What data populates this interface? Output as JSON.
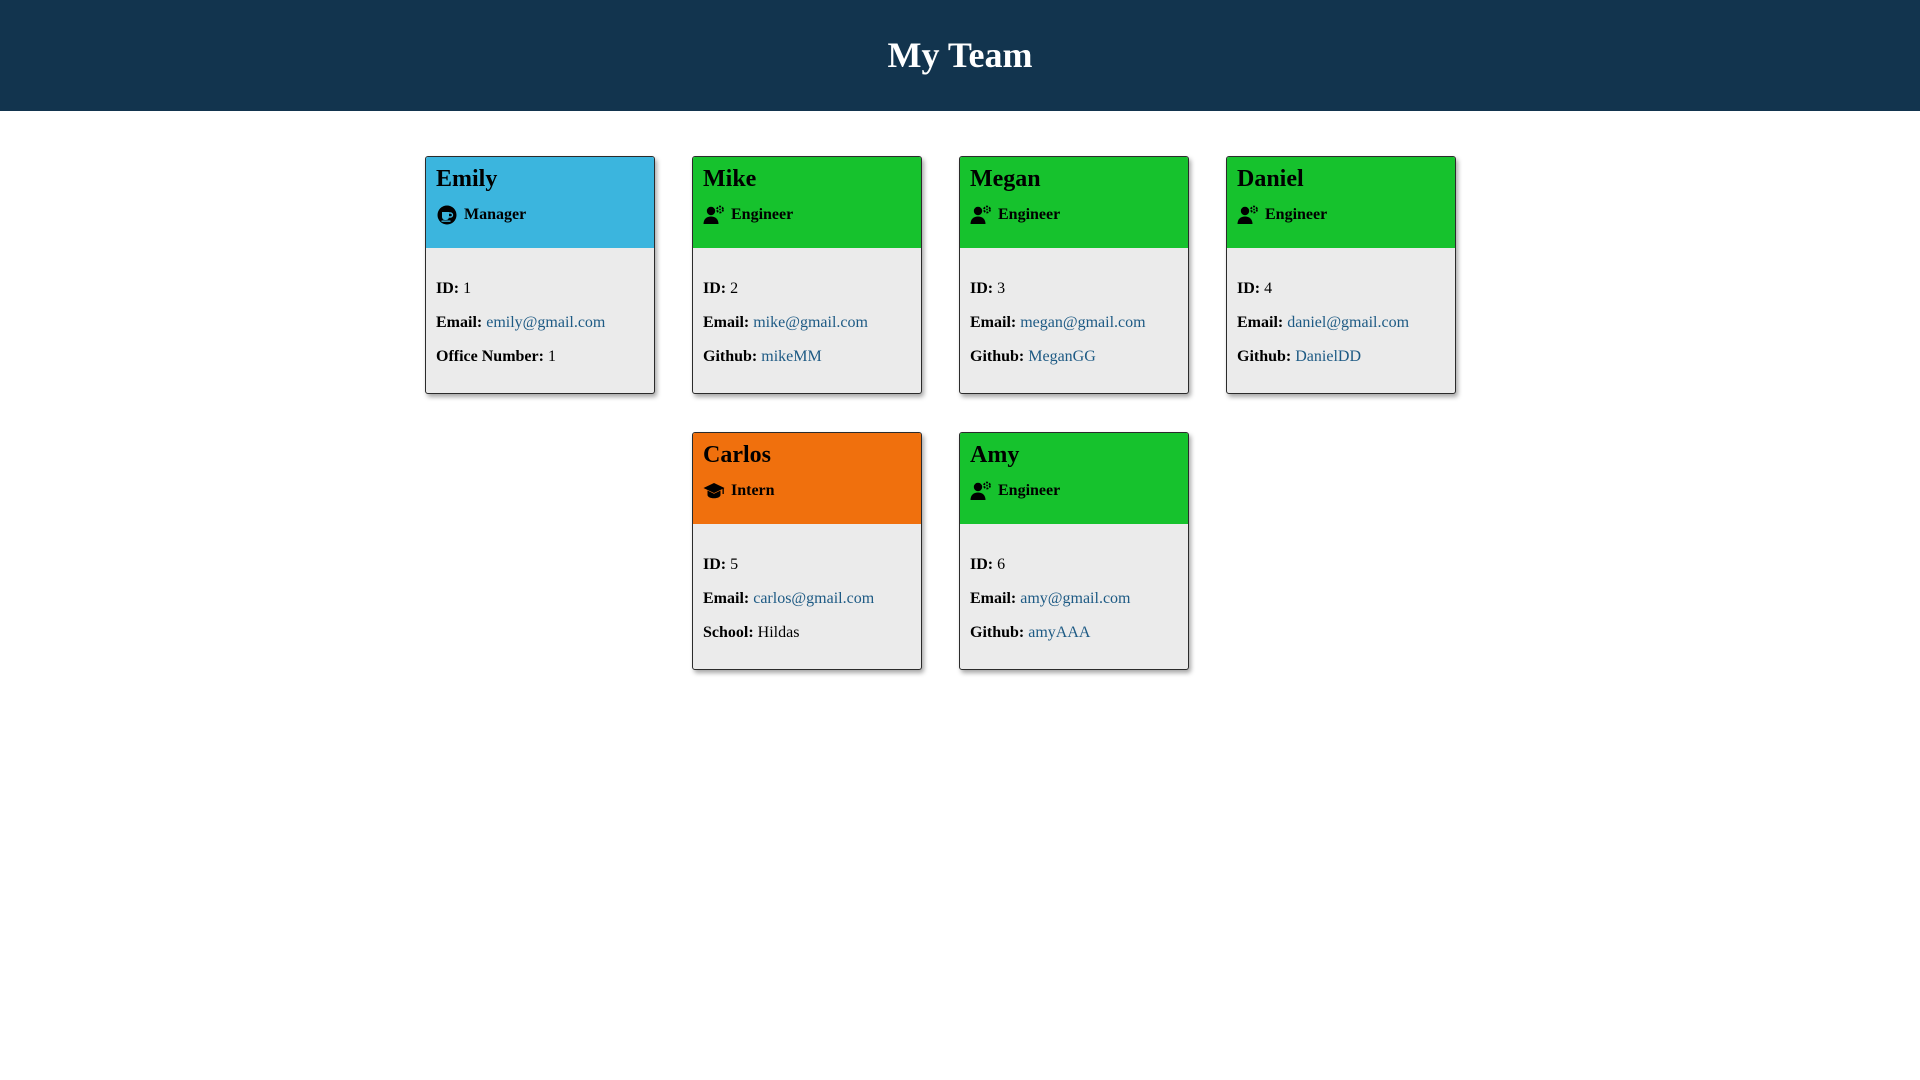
{
  "page": {
    "title": "My Team"
  },
  "colors": {
    "header_bg": "#12344e",
    "manager": "#3bb5de",
    "engineer": "#16c22d",
    "intern": "#f0700d",
    "link": "#1d5a84",
    "card_body": "#ebebeb"
  },
  "labels": {
    "id": "ID:",
    "email": "Email:",
    "office": "Office Number:",
    "github": "Github:",
    "school": "School:"
  },
  "team": [
    {
      "name": "Emily",
      "role": "Manager",
      "icon": "coffee-mug-icon",
      "id": "1",
      "email": "emily@gmail.com",
      "extra_label": "Office Number:",
      "extra_value": "1"
    },
    {
      "name": "Mike",
      "role": "Engineer",
      "icon": "user-gear-icon",
      "id": "2",
      "email": "mike@gmail.com",
      "extra_label": "Github:",
      "extra_value": "mikeMM"
    },
    {
      "name": "Megan",
      "role": "Engineer",
      "icon": "user-gear-icon",
      "id": "3",
      "email": "megan@gmail.com",
      "extra_label": "Github:",
      "extra_value": "MeganGG"
    },
    {
      "name": "Daniel",
      "role": "Engineer",
      "icon": "user-gear-icon",
      "id": "4",
      "email": "daniel@gmail.com",
      "extra_label": "Github:",
      "extra_value": "DanielDD"
    },
    {
      "name": "Carlos",
      "role": "Intern",
      "icon": "graduation-cap-icon",
      "id": "5",
      "email": "carlos@gmail.com",
      "extra_label": "School:",
      "extra_value": "Hildas"
    },
    {
      "name": "Amy",
      "role": "Engineer",
      "icon": "user-gear-icon",
      "id": "6",
      "email": "amy@gmail.com",
      "extra_label": "Github:",
      "extra_value": "amyAAA"
    }
  ]
}
